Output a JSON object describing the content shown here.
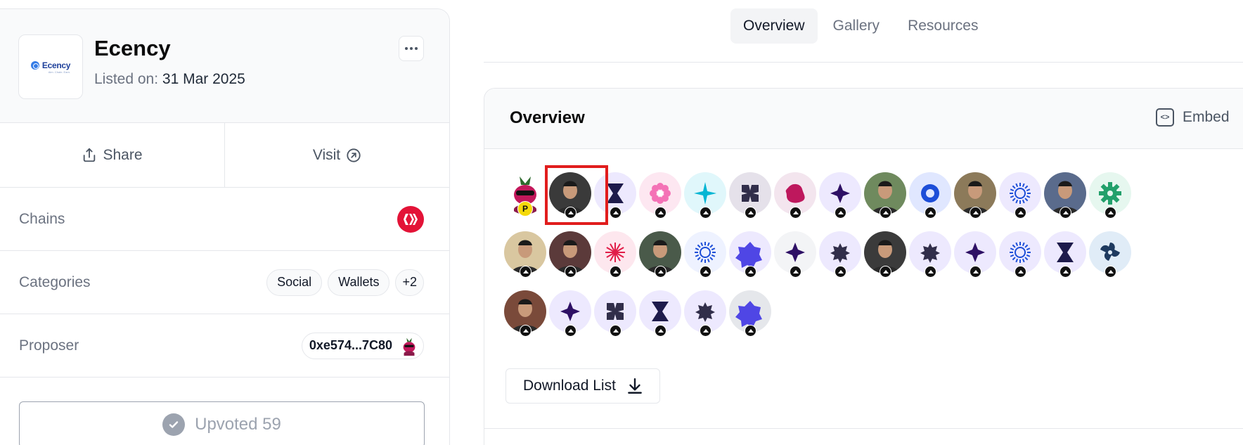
{
  "project": {
    "name": "Ecency",
    "logo_text": "Ecency",
    "logo_tagline": "Aim. Chain. Earn.",
    "listed_label": "Listed on:",
    "listed_date": "31 Mar 2025"
  },
  "actions": {
    "share": "Share",
    "visit": "Visit"
  },
  "details": {
    "chains_label": "Chains",
    "chain_icon": "hive-icon",
    "categories_label": "Categories",
    "categories": [
      "Social",
      "Wallets",
      "+2"
    ],
    "proposer_label": "Proposer",
    "proposer_address": "0xe574...7C80"
  },
  "upvote": {
    "label": "Upvoted 59"
  },
  "tabs": [
    "Overview",
    "Gallery",
    "Resources"
  ],
  "active_tab": "Overview",
  "overview": {
    "title": "Overview",
    "embed_label": "Embed",
    "download_label": "Download List",
    "voter_count": 33,
    "proposer_badge": "P"
  },
  "colors": {
    "hive_red": "#e31337",
    "highlight": "#e11d1d",
    "accent_navy": "#1e1b4b"
  }
}
